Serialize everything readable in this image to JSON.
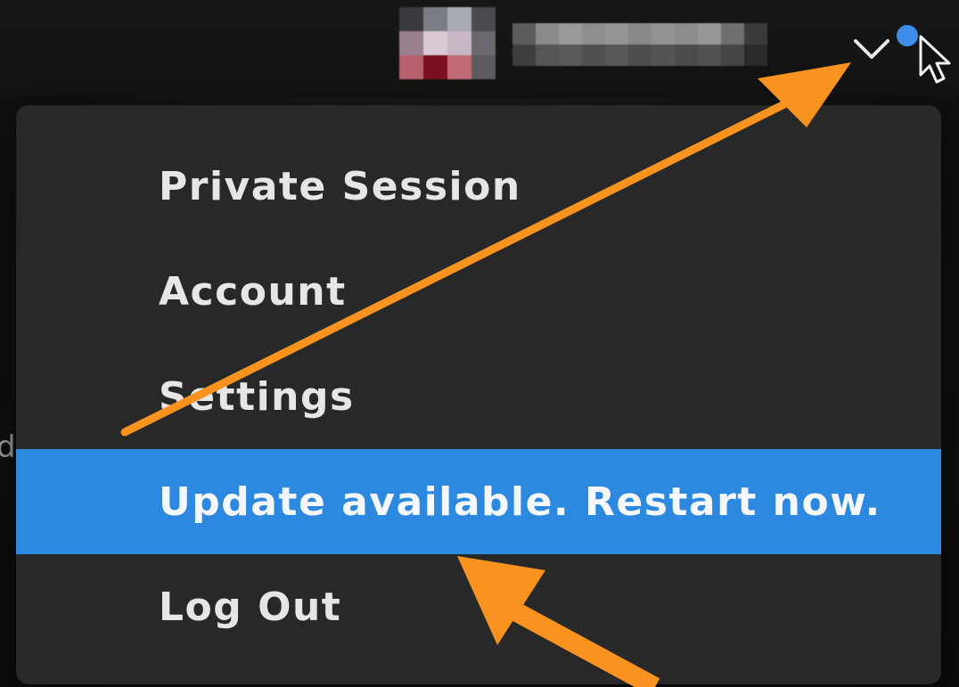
{
  "menu": {
    "items": [
      {
        "label": "Private Session",
        "highlighted": false
      },
      {
        "label": "Account",
        "highlighted": false
      },
      {
        "label": "Settings",
        "highlighted": false
      },
      {
        "label": "Update available. Restart now.",
        "highlighted": true
      },
      {
        "label": "Log Out",
        "highlighted": false
      }
    ]
  },
  "header": {
    "notification_dot": true,
    "dropdown_icon": "chevron-down-icon",
    "cursor_icon": "pointer-cursor-icon"
  },
  "side_text": "d",
  "colors": {
    "menu_background": "#282828",
    "highlight": "#2d89e0",
    "notification_dot": "#3d8de8",
    "annotation_arrow": "#f7931e"
  }
}
